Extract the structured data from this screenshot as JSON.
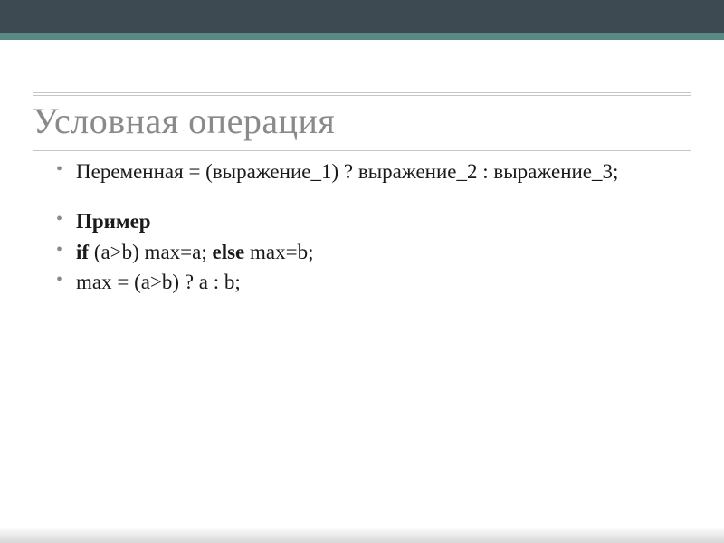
{
  "slide": {
    "title": "Условная операция",
    "items": [
      {
        "text": "Переменная = (выражение_1) ? выражение_2 : выражение_3;"
      }
    ],
    "example_label": "Пример",
    "example_lines": {
      "l1_if": "if",
      "l1_mid": " (a>b) max=a; ",
      "l1_else": "else",
      "l1_end": " max=b;",
      "l2": "max = (a>b) ? a : b;"
    }
  }
}
